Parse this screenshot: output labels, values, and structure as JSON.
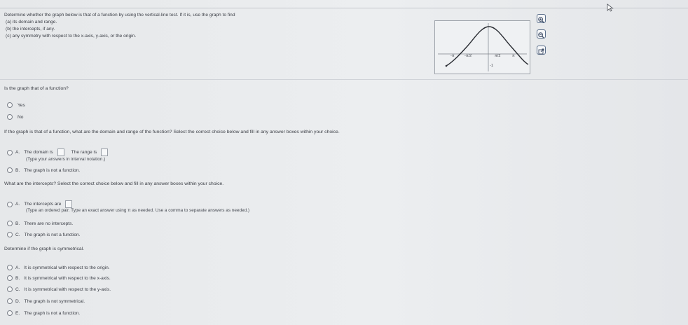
{
  "prompt": {
    "line1": "Determine whether the graph below is that of a function by using the vertical-line test. If it is, use the graph to find",
    "line2": "(a) its domain and range.",
    "line3": "(b) the intercepts, if any.",
    "line4": "(c) any symmetry with respect to the x-axis, y-axis, or the origin."
  },
  "graph": {
    "x_ticks": [
      "-π",
      "-π/2",
      "π/2",
      "π"
    ],
    "y_tick": "-1"
  },
  "q1": {
    "question": "Is the graph that of a function?",
    "options": [
      {
        "label": "Yes"
      },
      {
        "label": "No"
      }
    ]
  },
  "q2": {
    "question": "If the graph is that of a function, what are the domain and range of the function? Select the correct choice below and fill in any answer boxes within your choice.",
    "optA_letter": "A.",
    "optA_domain": "The domain is",
    "optA_range": "The range is",
    "optA_hint": "(Type your answers in interval notation.)",
    "optB_letter": "B.",
    "optB_text": "The graph is not a function."
  },
  "q3": {
    "question": "What are the intercepts? Select the correct choice below and fill in any answer boxes within your choice.",
    "optA_letter": "A.",
    "optA_text": "The intercepts are",
    "optA_hint": "(Type an ordered pair. Type an exact answer using π as needed. Use a comma to separate answers as needed.)",
    "optB_letter": "B.",
    "optB_text": "There are no intercepts.",
    "optC_letter": "C.",
    "optC_text": "The graph is not a function."
  },
  "q4": {
    "question": "Determine if the graph is symmetrical.",
    "options": [
      {
        "letter": "A.",
        "text": "It is symmetrical with respect to the origin."
      },
      {
        "letter": "B.",
        "text": "It is symmetrical with respect to the x-axis."
      },
      {
        "letter": "C.",
        "text": "It is symmetrical with respect to the y-axis."
      },
      {
        "letter": "D.",
        "text": "The graph is not symmetrical."
      },
      {
        "letter": "E.",
        "text": "The graph is not a function."
      }
    ]
  },
  "tools": [
    "zoom-in-icon",
    "zoom-out-icon",
    "open-in-new-window-icon"
  ],
  "colors": {
    "tool_border": "#5a6e8a",
    "curve": "#2a2d33"
  }
}
